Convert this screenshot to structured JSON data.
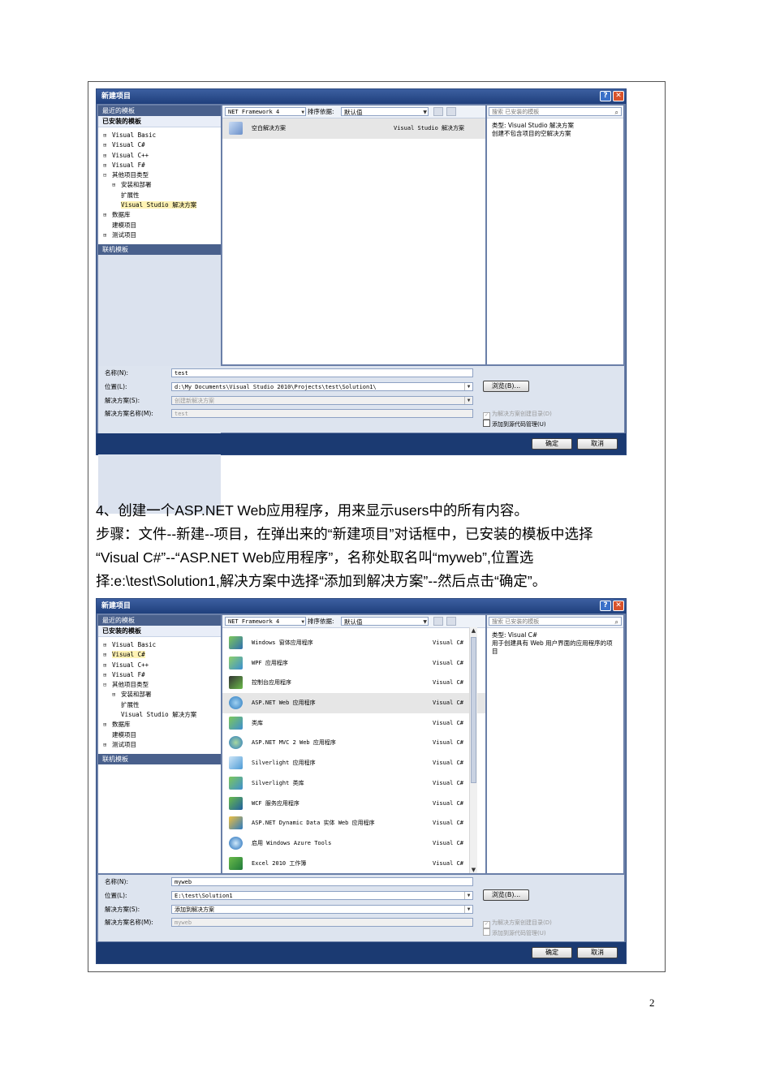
{
  "page_number": "2",
  "step": {
    "heading": "4、创建一个ASP.NET Web应用程序，用来显示users中的所有内容。",
    "lines": [
      "步骤：文件--新建--项目，在弹出来的“新建项目”对话框中，已安装的模板中选择",
      "“Visual C#”--“ASP.NET Web应用程序”，名称处取名叫“myweb”,位置选",
      "择:e:\\test\\Solution1,解决方案中选择“添加到解决方案”--然后点击“确定”。"
    ]
  },
  "dialog1": {
    "title": "新建项目",
    "recent_templates": "最近的模板",
    "installed_templates": "已安装的模板",
    "online_templates": "联机模板",
    "tree": [
      "Visual Basic",
      "Visual C#",
      "Visual C++",
      "Visual F#",
      "其他项目类型",
      "安装和部署",
      "扩展性",
      "Visual Studio 解决方案",
      "数据库",
      "建模项目",
      "测试项目"
    ],
    "framework": "NET Framework 4",
    "sort_label": "排序依据:",
    "sort_value": "默认值",
    "search_placeholder": "搜索 已安装的模板",
    "items": [
      {
        "name": "空白解决方案",
        "lang": "Visual Studio 解决方案"
      }
    ],
    "desc_type": "类型: Visual Studio 解决方案",
    "desc_text": "创建不包含项目的空解决方案",
    "name_label": "名称(N):",
    "name_value": "test",
    "location_label": "位置(L):",
    "location_value": "d:\\My Documents\\Visual Studio 2010\\Projects\\test\\Solution1\\",
    "solution_label": "解决方案(S):",
    "solution_value": "创建新解决方案",
    "solution_name_label": "解决方案名称(M):",
    "solution_name_value": "test",
    "browse": "浏览(B)...",
    "create_dir": "为解决方案创建目录(D)",
    "add_source_control": "添加到源代码管理(U)",
    "ok": "确定",
    "cancel": "取消"
  },
  "dialog2": {
    "title": "新建项目",
    "recent_templates": "最近的模板",
    "installed_templates": "已安装的模板",
    "online_templates": "联机模板",
    "tree": [
      "Visual Basic",
      "Visual C#",
      "Visual C++",
      "Visual F#",
      "其他项目类型",
      "安装和部署",
      "扩展性",
      "Visual Studio 解决方案",
      "数据库",
      "建模项目",
      "测试项目"
    ],
    "framework": "NET Framework 4",
    "sort_label": "排序依据:",
    "sort_value": "默认值",
    "search_placeholder": "搜索 已安装的模板",
    "items": [
      {
        "name": "Windows 窗体应用程序",
        "lang": "Visual C#"
      },
      {
        "name": "WPF 应用程序",
        "lang": "Visual C#"
      },
      {
        "name": "控制台应用程序",
        "lang": "Visual C#"
      },
      {
        "name": "ASP.NET Web 应用程序",
        "lang": "Visual C#"
      },
      {
        "name": "类库",
        "lang": "Visual C#"
      },
      {
        "name": "ASP.NET MVC 2 Web 应用程序",
        "lang": "Visual C#"
      },
      {
        "name": "Silverlight 应用程序",
        "lang": "Visual C#"
      },
      {
        "name": "Silverlight 类库",
        "lang": "Visual C#"
      },
      {
        "name": "WCF 服务应用程序",
        "lang": "Visual C#"
      },
      {
        "name": "ASP.NET Dynamic Data 实体 Web 应用程序",
        "lang": "Visual C#"
      },
      {
        "name": "启用 Windows Azure Tools",
        "lang": "Visual C#"
      },
      {
        "name": "Excel 2010 工作簿",
        "lang": "Visual C#"
      }
    ],
    "desc_type": "类型: Visual C#",
    "desc_text": "用于创建具有 Web 用户界面的应用程序的项目",
    "name_label": "名称(N):",
    "name_value": "myweb",
    "location_label": "位置(L):",
    "location_value": "E:\\test\\Solution1",
    "solution_label": "解决方案(S):",
    "solution_value": "添加到解决方案",
    "solution_name_label": "解决方案名称(M):",
    "solution_name_value": "myweb",
    "browse": "浏览(B)...",
    "create_dir": "为解决方案创建目录(D)",
    "add_source_control": "添加到源代码管理(U)",
    "ok": "确定",
    "cancel": "取消"
  },
  "colors": {
    "title_bar": "#1f3f7c",
    "dialog_border": "#6a7fa8",
    "footer": "#1b3a72",
    "selected_item": "#e6e6e6"
  }
}
